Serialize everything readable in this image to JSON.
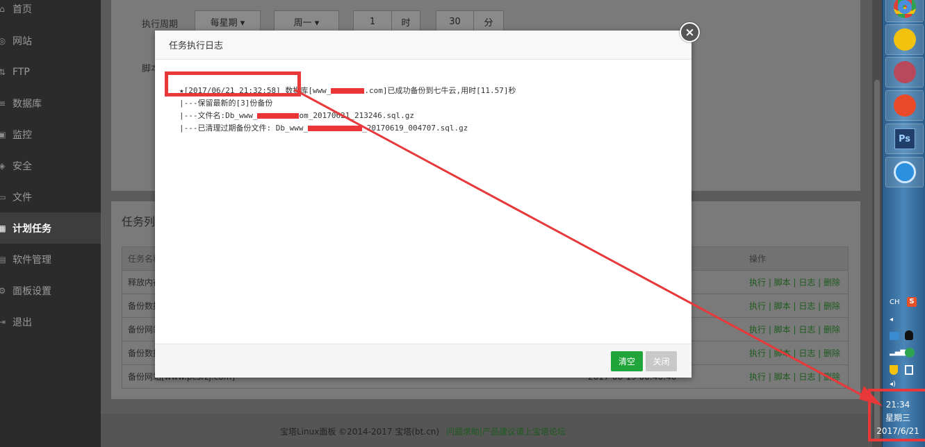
{
  "sidebar": {
    "items": [
      {
        "label": "首页",
        "icon": "home-icon"
      },
      {
        "label": "网站",
        "icon": "globe-icon"
      },
      {
        "label": "FTP",
        "icon": "ftp-icon"
      },
      {
        "label": "数据库",
        "icon": "database-icon"
      },
      {
        "label": "监控",
        "icon": "monitor-icon"
      },
      {
        "label": "安全",
        "icon": "shield-icon"
      },
      {
        "label": "文件",
        "icon": "folder-icon"
      },
      {
        "label": "计划任务",
        "icon": "calendar-icon",
        "active": true
      },
      {
        "label": "软件管理",
        "icon": "apps-icon"
      },
      {
        "label": "面板设置",
        "icon": "gear-icon"
      },
      {
        "label": "退出",
        "icon": "logout-icon"
      }
    ]
  },
  "form": {
    "cycle_label": "执行周期",
    "cycle_value": "每星期 ▾",
    "weekday_value": "周一 ▾",
    "hour_value": "1",
    "hour_unit": "时",
    "minute_value": "30",
    "minute_unit": "分",
    "script_label": "脚本"
  },
  "task_list": {
    "title": "任务列",
    "headers": {
      "name": "任务名称",
      "ops": "操作"
    },
    "rows": [
      {
        "name": "释放内存",
        "time": "",
        "ops": "执行 | 脚本 | 日志 | 删除"
      },
      {
        "name": "备份数据",
        "time": "",
        "ops": "执行 | 脚本 | 日志 | 删除"
      },
      {
        "name": "备份网站",
        "time": "",
        "ops": "执行 | 脚本 | 日志 | 删除"
      },
      {
        "name": "备份数据",
        "time": "",
        "ops": "执行 | 脚本 | 日志 | 删除"
      },
      {
        "name": "备份网站[www.pcsrzj.com]",
        "time": "2017-06-19 00:40:40",
        "ops": "执行 | 脚本 | 日志 | 删除"
      }
    ]
  },
  "footer": {
    "copyright": "宝塔Linux面板 ©2014-2017 宝塔(bt.cn)",
    "links": "问题求助|产品建议请上宝塔论坛"
  },
  "modal": {
    "title": "任务执行日志",
    "log": {
      "line1_prefix": "★[2017/06/21 21:32:58] 数据库[www_",
      "line1_suffix": ".com]已成功备份到七牛云,用时[11.57]秒",
      "line2": "|---保留最新的[3]份备份",
      "line3_prefix": "|---文件名:Db_www_",
      "line3_suffix": "om_20170621_213246.sql.gz",
      "line4_prefix": "|---已清理过期备份文件: Db_www_",
      "line4_suffix": "_20170619_004707.sql.gz"
    },
    "clear_button": "清空",
    "close_button": "关闭",
    "close_x": "×"
  },
  "taskbar": {
    "apps": [
      {
        "name": "chrome-icon",
        "color": "#e0403a"
      },
      {
        "name": "music-icon",
        "color": "#f2c20d"
      },
      {
        "name": "photo-app-icon",
        "color": "#b8485a"
      },
      {
        "name": "bird-app-icon",
        "color": "#e84a2a"
      },
      {
        "name": "photoshop-icon",
        "color": "#1f3f6a",
        "label": "Ps"
      },
      {
        "name": "browser-icon",
        "color": "#2d8fe0"
      }
    ],
    "ime": "CH",
    "ime_logo": "S",
    "clock": {
      "time": "21:34",
      "weekday": "星期三",
      "date": "2017/6/21"
    }
  }
}
